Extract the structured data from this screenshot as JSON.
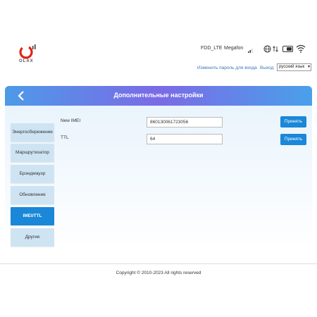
{
  "header": {
    "logo_text": "OLAX",
    "network_type": "FDD_LTE",
    "operator": "Megafon",
    "change_password_link": "Изменить пароль для входа",
    "logout_link": "Выход",
    "language": "русский язык",
    "icons": [
      "signal-icon",
      "globe-icon",
      "data-arrows-icon",
      "battery-toggle-icon",
      "wifi-icon"
    ]
  },
  "banner": {
    "title": "Дополнительные настройки",
    "back_icon": "chevron-left-icon"
  },
  "sidebar": {
    "items": [
      {
        "label": "Энергосбережение",
        "active": false
      },
      {
        "label": "Маршрутизатор",
        "active": false
      },
      {
        "label": "Брэндмауэр",
        "active": false
      },
      {
        "label": "Обновление",
        "active": false
      },
      {
        "label": "IMEI/TTL",
        "active": true
      },
      {
        "label": "Другие",
        "active": false
      }
    ]
  },
  "form": {
    "imei": {
      "label": "New IMEI",
      "value": "860130061723056",
      "button": "Принять"
    },
    "ttl": {
      "label": "TTL",
      "value": "64",
      "button": "Принять"
    }
  },
  "footer": {
    "copyright": "Copyright © 2010-2023 All rights reserved"
  },
  "colors": {
    "accent": "#1a87d8",
    "banner_start": "#4d9ae8",
    "banner_mid": "#7b6ae6",
    "link": "#3a78b8",
    "logo_red": "#e0241b"
  }
}
